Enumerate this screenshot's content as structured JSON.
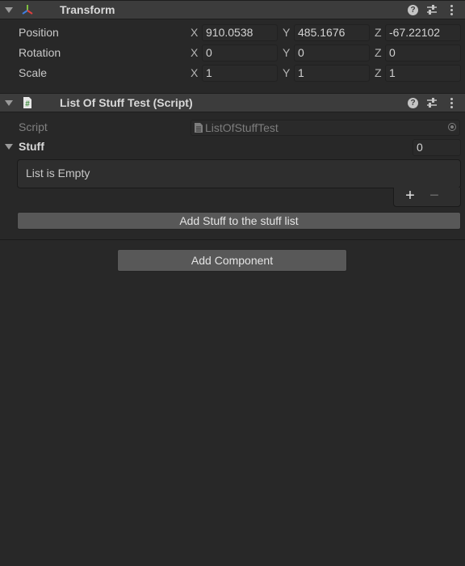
{
  "transform": {
    "title": "Transform",
    "rows": [
      {
        "label": "Position",
        "x": "910.0538",
        "y": "485.1676",
        "z": "-67.22102"
      },
      {
        "label": "Rotation",
        "x": "0",
        "y": "0",
        "z": "0"
      },
      {
        "label": "Scale",
        "x": "1",
        "y": "1",
        "z": "1"
      }
    ],
    "axes": {
      "x": "X",
      "y": "Y",
      "z": "Z"
    }
  },
  "script_component": {
    "title": "List Of Stuff Test (Script)",
    "script_label": "Script",
    "script_value": "ListOfStuffTest",
    "list_label": "Stuff",
    "list_size": "0",
    "empty_text": "List is Empty",
    "add_symbol": "+",
    "remove_symbol": "−",
    "button_label": "Add Stuff to the stuff list"
  },
  "help_symbol": "?",
  "add_component_label": "Add Component",
  "icons": {
    "transform": "transform-axes-icon",
    "script": "csharp-script-icon",
    "help": "help-icon",
    "presets": "presets-icon",
    "menu": "kebab-menu-icon",
    "object_picker": "object-picker-icon"
  },
  "colors": {
    "background": "#282828",
    "header": "#3c3c3c",
    "field": "#2a2a2a",
    "button": "#585858"
  }
}
